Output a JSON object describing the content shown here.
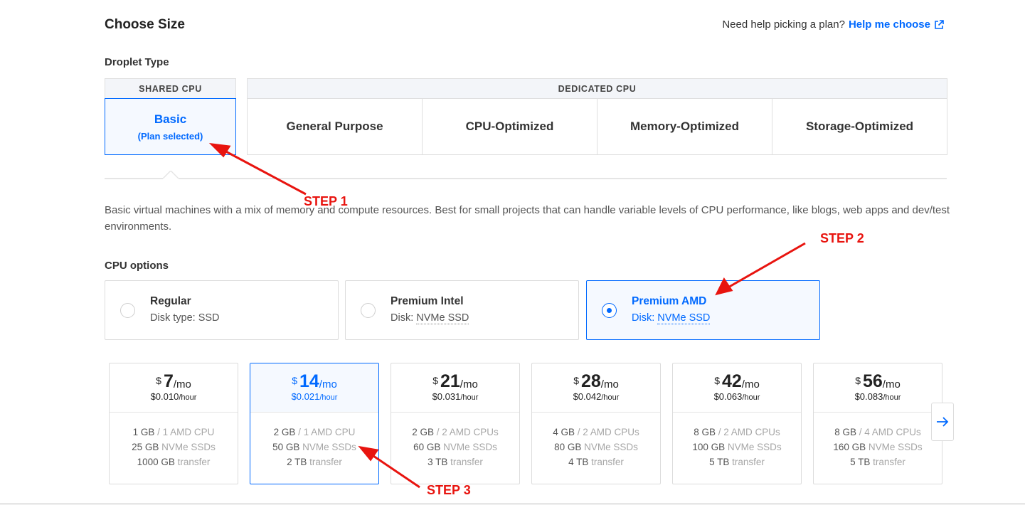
{
  "header": {
    "title": "Choose Size",
    "help_text": "Need help picking a plan?",
    "help_link": "Help me choose"
  },
  "droplet_type": {
    "label": "Droplet Type",
    "shared_header": "SHARED CPU",
    "basic_label": "Basic",
    "basic_sub": "(Plan selected)",
    "dedicated_header": "DEDICATED CPU",
    "dedicated_options": [
      "General Purpose",
      "CPU-Optimized",
      "Memory-Optimized",
      "Storage-Optimized"
    ]
  },
  "description": "Basic virtual machines with a mix of memory and compute resources. Best for small projects that can handle variable levels of CPU performance, like blogs, web apps and dev/test environments.",
  "cpu_options": {
    "label": "CPU options",
    "items": [
      {
        "name": "Regular",
        "disk_prefix": "Disk type: ",
        "disk": "SSD",
        "selected": false
      },
      {
        "name": "Premium Intel",
        "disk_prefix": "Disk: ",
        "disk": "NVMe SSD",
        "selected": false
      },
      {
        "name": "Premium AMD",
        "disk_prefix": "Disk: ",
        "disk": "NVMe SSD",
        "selected": true
      }
    ]
  },
  "plans": [
    {
      "currency": "$",
      "price": "7",
      "per": "/mo",
      "hourly": "$0.010",
      "hour_unit": "/hour",
      "mem": "1 GB",
      "cpu": " / 1 AMD CPU",
      "disk": "25 GB",
      "disk_label": " NVMe SSDs",
      "transfer": "1000 GB",
      "transfer_label": " transfer",
      "selected": false
    },
    {
      "currency": "$",
      "price": "14",
      "per": "/mo",
      "hourly": "$0.021",
      "hour_unit": "/hour",
      "mem": "2 GB",
      "cpu": " / 1 AMD CPU",
      "disk": "50 GB",
      "disk_label": " NVMe SSDs",
      "transfer": "2 TB",
      "transfer_label": " transfer",
      "selected": true
    },
    {
      "currency": "$",
      "price": "21",
      "per": "/mo",
      "hourly": "$0.031",
      "hour_unit": "/hour",
      "mem": "2 GB",
      "cpu": " / 2 AMD CPUs",
      "disk": "60 GB",
      "disk_label": " NVMe SSDs",
      "transfer": "3 TB",
      "transfer_label": " transfer",
      "selected": false
    },
    {
      "currency": "$",
      "price": "28",
      "per": "/mo",
      "hourly": "$0.042",
      "hour_unit": "/hour",
      "mem": "4 GB",
      "cpu": " / 2 AMD CPUs",
      "disk": "80 GB",
      "disk_label": " NVMe SSDs",
      "transfer": "4 TB",
      "transfer_label": " transfer",
      "selected": false
    },
    {
      "currency": "$",
      "price": "42",
      "per": "/mo",
      "hourly": "$0.063",
      "hour_unit": "/hour",
      "mem": "8 GB",
      "cpu": " / 2 AMD CPUs",
      "disk": "100 GB",
      "disk_label": " NVMe SSDs",
      "transfer": "5 TB",
      "transfer_label": " transfer",
      "selected": false
    },
    {
      "currency": "$",
      "price": "56",
      "per": "/mo",
      "hourly": "$0.083",
      "hour_unit": "/hour",
      "mem": "8 GB",
      "cpu": " / 4 AMD CPUs",
      "disk": "160 GB",
      "disk_label": " NVMe SSDs",
      "transfer": "5 TB",
      "transfer_label": " transfer",
      "selected": false
    }
  ],
  "annotations": {
    "step1": "STEP 1",
    "step2": "STEP 2",
    "step3": "STEP 3",
    "color": "#e8140f"
  },
  "colors": {
    "accent": "#0069ff",
    "selected_bg": "#f5f9ff"
  },
  "icons": {
    "help_link": "external-link-icon",
    "next": "arrow-right-icon"
  }
}
